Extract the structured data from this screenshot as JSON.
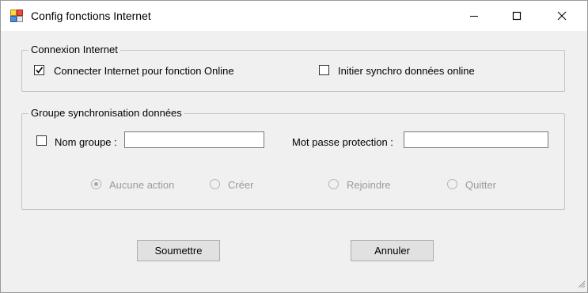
{
  "window": {
    "title": "Config fonctions Internet",
    "icon": "app-window-icon",
    "controls": {
      "minimize": "minimize-icon",
      "maximize": "maximize-icon",
      "close": "close-icon"
    }
  },
  "connexion_group": {
    "legend": "Connexion Internet",
    "connect_checkbox": {
      "label": "Connecter Internet pour fonction Online",
      "checked": true
    },
    "sync_checkbox": {
      "label": "Initier synchro données online",
      "checked": false
    }
  },
  "sync_group": {
    "legend": "Groupe synchronisation données",
    "group_name_checkbox": {
      "label": "Nom groupe :",
      "checked": false
    },
    "group_name_value": "",
    "password_label": "Mot passe protection :",
    "password_value": "",
    "radios": [
      {
        "label": "Aucune action",
        "selected": true,
        "enabled": false
      },
      {
        "label": "Créer",
        "selected": false,
        "enabled": false
      },
      {
        "label": "Rejoindre",
        "selected": false,
        "enabled": false
      },
      {
        "label": "Quitter",
        "selected": false,
        "enabled": false
      }
    ]
  },
  "buttons": {
    "submit_label": "Soumettre",
    "cancel_label": "Annuler"
  },
  "colors": {
    "title_bar": "#ffffff",
    "client_background": "#f0f0f0",
    "button_face": "#e1e1e1",
    "disabled_text": "#9a9a9a"
  }
}
